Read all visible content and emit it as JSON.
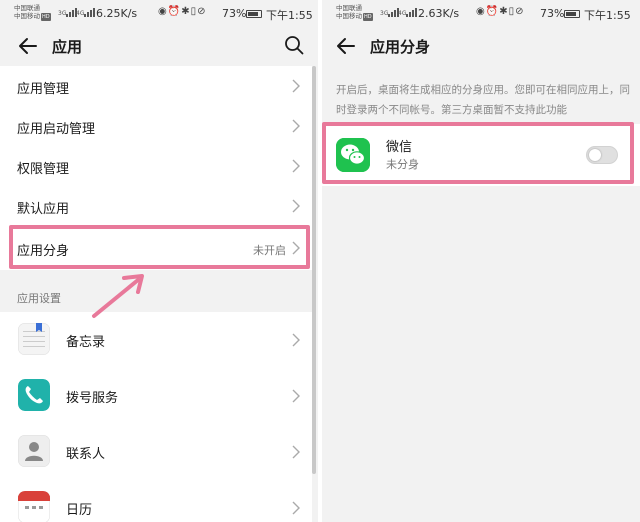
{
  "colors": {
    "highlight": "#e8799a",
    "wechat_green": "#1fc24f",
    "phone_teal": "#20b2aa",
    "calendar_red": "#d9413a",
    "notes_blue": "#3a6fd6"
  },
  "left": {
    "status": {
      "carrier1": "中国联通",
      "carrier2": "中国移动",
      "hd": "HD",
      "net1": "3G",
      "net2": "4G",
      "speed": "6.25K/s",
      "battery": "73%",
      "time": "下午1:55"
    },
    "title": "应用",
    "menu": [
      {
        "label": "应用管理",
        "value": ""
      },
      {
        "label": "应用启动管理",
        "value": ""
      },
      {
        "label": "权限管理",
        "value": ""
      },
      {
        "label": "默认应用",
        "value": ""
      },
      {
        "label": "应用分身",
        "value": "未开启"
      }
    ],
    "section_title": "应用设置",
    "apps": [
      {
        "label": "备忘录",
        "icon": "notes-icon"
      },
      {
        "label": "拨号服务",
        "icon": "phone-icon"
      },
      {
        "label": "联系人",
        "icon": "contacts-icon"
      },
      {
        "label": "日历",
        "icon": "calendar-icon"
      }
    ]
  },
  "right": {
    "status": {
      "carrier1": "中国联通",
      "carrier2": "中国移动",
      "hd": "HD",
      "net1": "3G",
      "net2": "4G",
      "speed": "2.63K/s",
      "battery": "73%",
      "time": "下午1:55"
    },
    "title": "应用分身",
    "description": "开启后，桌面将生成相应的分身应用。您即可在相同应用上，同时登录两个不同帐号。第三方桌面暂不支持此功能",
    "app": {
      "name": "微信",
      "status": "未分身",
      "toggle_on": false,
      "icon": "wechat-icon"
    }
  }
}
